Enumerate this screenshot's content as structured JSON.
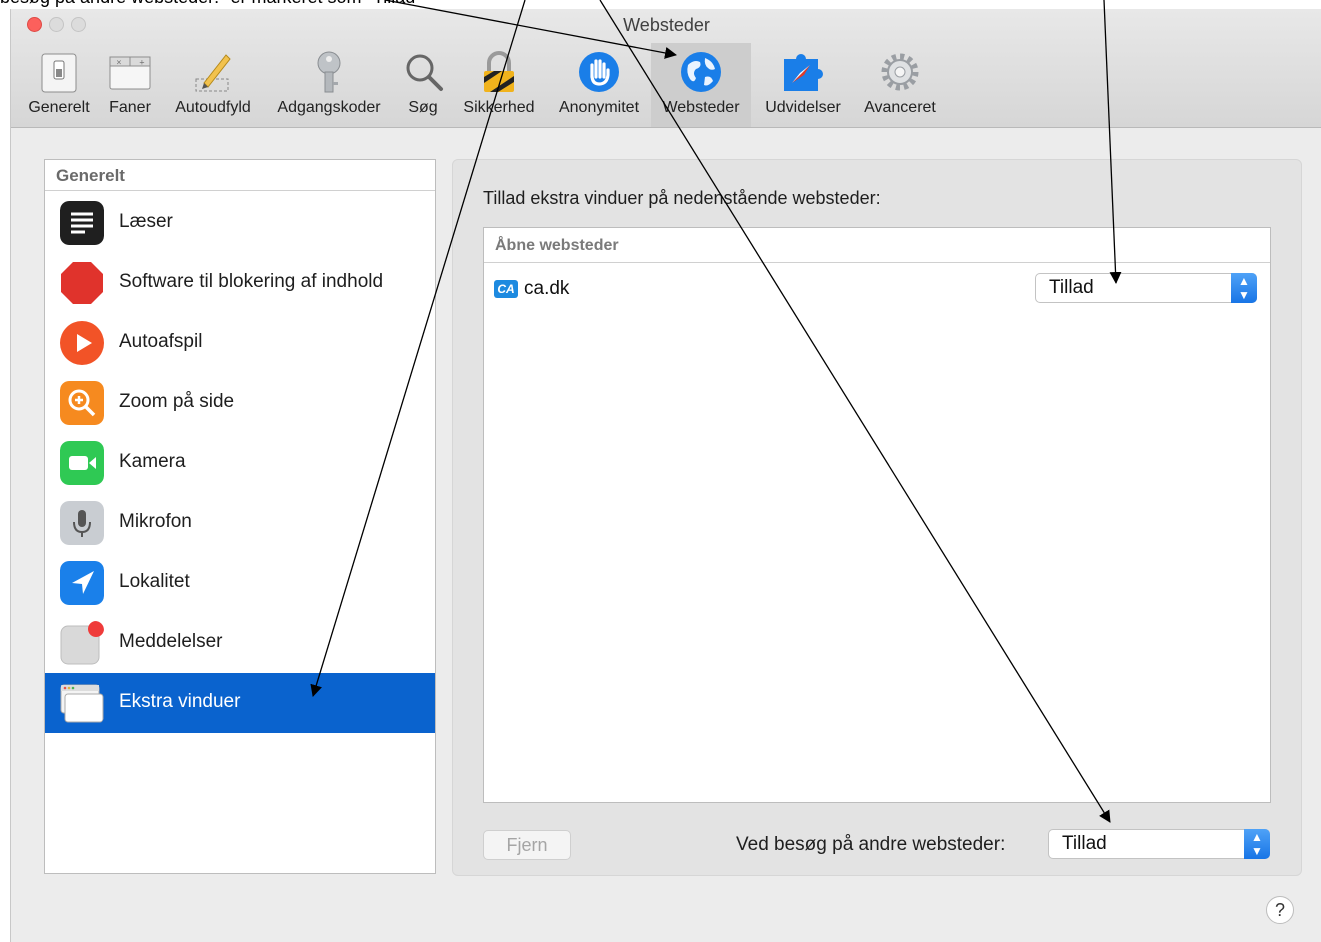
{
  "caption": "besøg på andre websteder:\" er markeret som \"Tillad\"",
  "window": {
    "title": "Websteder"
  },
  "toolbar": {
    "items": [
      {
        "label": "Generelt",
        "icon": "switch-icon"
      },
      {
        "label": "Faner",
        "icon": "tabs-icon"
      },
      {
        "label": "Autoudfyld",
        "icon": "pencil-icon"
      },
      {
        "label": "Adgangskoder",
        "icon": "key-icon"
      },
      {
        "label": "Søg",
        "icon": "magnifier-icon"
      },
      {
        "label": "Sikkerhed",
        "icon": "lock-icon"
      },
      {
        "label": "Anonymitet",
        "icon": "hand-icon"
      },
      {
        "label": "Websteder",
        "icon": "globe-icon",
        "active": true
      },
      {
        "label": "Udvidelser",
        "icon": "puzzle-icon"
      },
      {
        "label": "Avanceret",
        "icon": "gear-icon"
      }
    ]
  },
  "sidebar": {
    "header": "Generelt",
    "items": [
      {
        "label": "Læser",
        "icon": "reader-icon",
        "color": "#1f1f1f"
      },
      {
        "label": "Software til blokering af indhold",
        "icon": "stop-icon",
        "color": "#e0332c"
      },
      {
        "label": "Autoafspil",
        "icon": "play-icon",
        "color": "#f25327"
      },
      {
        "label": "Zoom på side",
        "icon": "zoom-icon",
        "color": "#f68a1f"
      },
      {
        "label": "Kamera",
        "icon": "camera-icon",
        "color": "#2fc954"
      },
      {
        "label": "Mikrofon",
        "icon": "microphone-icon",
        "color": "#c9cdd2"
      },
      {
        "label": "Lokalitet",
        "icon": "location-icon",
        "color": "#1a80ea"
      },
      {
        "label": "Meddelelser",
        "icon": "notifications-icon",
        "color": "#d9d9d9"
      },
      {
        "label": "Ekstra vinduer",
        "icon": "popup-windows-icon",
        "color": "#ffffff",
        "selected": true
      }
    ]
  },
  "main": {
    "heading": "Tillad ekstra vinduer på nedenstående websteder:",
    "table_header": "Åbne websteder",
    "rows": [
      {
        "site": "ca.dk",
        "icon_text": "CA",
        "value": "Tillad"
      }
    ],
    "remove_button": "Fjern",
    "other_label": "Ved besøg på andre websteder:",
    "other_value": "Tillad",
    "help": "?"
  }
}
